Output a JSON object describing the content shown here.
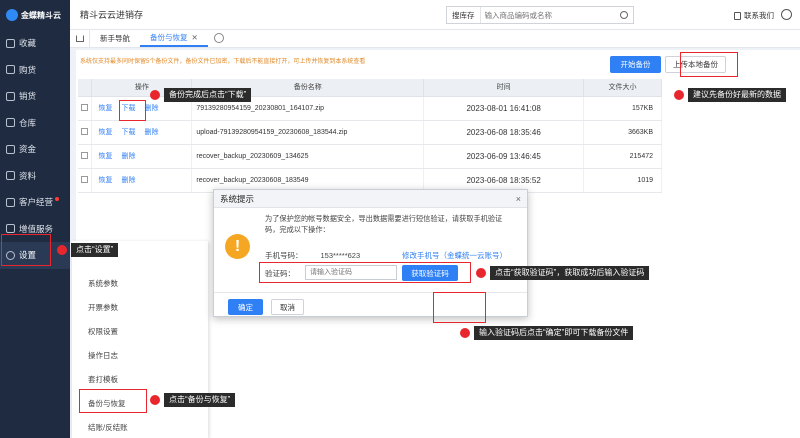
{
  "sidebar": {
    "logo_text": "金蝶精斗云",
    "items": [
      {
        "label": "收藏"
      },
      {
        "label": "购货"
      },
      {
        "label": "销货"
      },
      {
        "label": "仓库"
      },
      {
        "label": "资金"
      },
      {
        "label": "资料"
      },
      {
        "label": "客户经营"
      },
      {
        "label": "增值服务"
      },
      {
        "label": "设置"
      }
    ]
  },
  "topbar": {
    "title": "精斗云云进销存",
    "search_label": "搜库存",
    "search_placeholder": "输入商品编码或名称",
    "contact": "联系我们"
  },
  "tabs": [
    {
      "label": "新手导航"
    },
    {
      "label": "备份与恢复"
    }
  ],
  "notice": "系统仅支持最多同时保留5个备份文件，备份文件已加密，下载后不能直接打开，可上传并恢复到本系统查看",
  "buttons": {
    "start_backup": "开始备份",
    "upload_local": "上传本地备份"
  },
  "table": {
    "headers": [
      "操作",
      "备份名称",
      "时间",
      "文件大小"
    ],
    "rows": [
      {
        "ops": [
          "恢复",
          "下载",
          "删除"
        ],
        "name": "79139280954159_20230801_164107.zip",
        "time": "2023-08-01 16:41:08",
        "size": "157KB"
      },
      {
        "ops": [
          "恢复",
          "下载",
          "删除"
        ],
        "name": "upload-79139280954159_20230608_183544.zip",
        "time": "2023-06-08 18:35:46",
        "size": "3663KB"
      },
      {
        "ops": [
          "恢复",
          "删除"
        ],
        "name": "recover_backup_20230609_134625",
        "time": "2023-06-09 13:46:45",
        "size": "215472"
      },
      {
        "ops": [
          "恢复",
          "删除"
        ],
        "name": "recover_backup_20230608_183549",
        "time": "2023-06-08 18:35:52",
        "size": "1019"
      }
    ]
  },
  "submenu": {
    "items": [
      "系统参数",
      "开票参数",
      "权限设置",
      "操作日志",
      "套打模板",
      "备份与恢复",
      "结账/反结账"
    ]
  },
  "modal": {
    "title": "系统提示",
    "message": "为了保护您的帐号数据安全，导出数据需要进行短信验证，请获取手机验证码，完成以下操作：",
    "phone_label": "手机号码：",
    "phone_value": "153*****623",
    "modify_link": "修改手机号（金蝶统一云账号）",
    "code_label": "验证码：",
    "code_placeholder": "请输入验证码",
    "get_code": "获取验证码",
    "ok": "确定",
    "cancel": "取消"
  },
  "annotations": {
    "download": "备份完成后点击“下载”",
    "suggest": "建议先备份好最新的数据",
    "settings": "点击“设置”",
    "get_code": "点击“获取验证码”，获取成功后输入验证码",
    "confirm": "输入验证码后点击“确定”即可下载备份文件",
    "backup_restore": "点击“备份与恢复”"
  }
}
